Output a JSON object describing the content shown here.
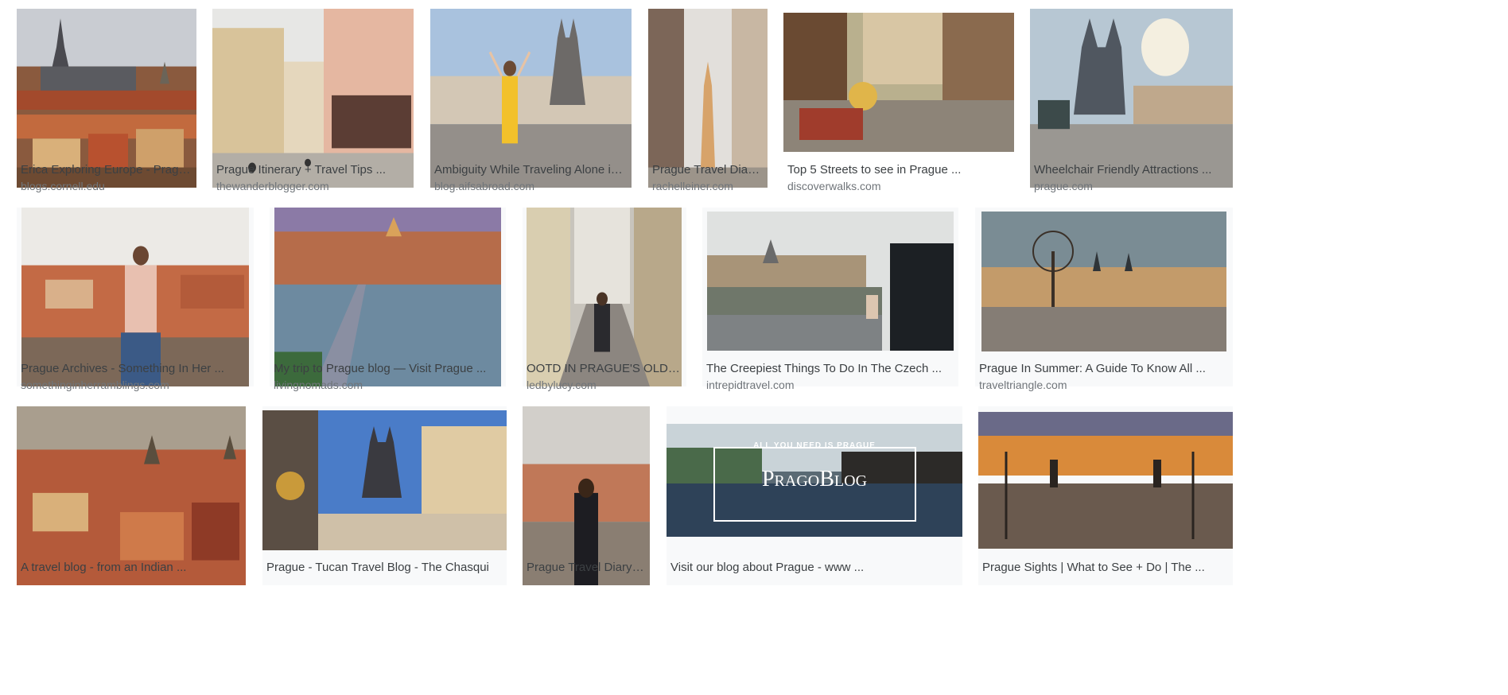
{
  "results": [
    [
      {
        "title": "Erica Exploring Europe - Prague Blog",
        "source": "blogs.cornell.edu",
        "thumb_icon": "prague-castle-panorama-image"
      },
      {
        "title": "Prague Itinerary + Travel Tips ...",
        "source": "thewanderblogger.com",
        "thumb_icon": "old-town-palace-street-image"
      },
      {
        "title": "Ambiguity While Traveling Alone in Prague",
        "source": "blog.aifsabroad.com",
        "thumb_icon": "woman-yellow-dress-square-image"
      },
      {
        "title": "Prague Travel Diary — ...",
        "source": "rachelleiner.com",
        "thumb_icon": "narrow-street-church-image"
      },
      {
        "title": "Top 5 Streets to see in Prague ...",
        "source": "discoverwalks.com",
        "thumb_icon": "cafe-street-image"
      },
      {
        "title": "Wheelchair Friendly Attractions ...",
        "source": "prague.com",
        "thumb_icon": "old-town-square-tyn-church-image"
      }
    ],
    [
      {
        "title": "Prague Archives - Something In Her ...",
        "source": "somethinginherramblings.com",
        "thumb_icon": "woman-sitting-rooftops-image"
      },
      {
        "title": "My trip to Prague blog — Visit Prague ...",
        "source": "livingnomads.com",
        "thumb_icon": "charles-bridge-aerial-image"
      },
      {
        "title": "OOTD IN PRAGUE'S OLD TOWN - ...",
        "source": "ledbylucy.com",
        "thumb_icon": "woman-cobblestone-alley-image"
      },
      {
        "title": "The Creepiest Things To Do In The Czech ...",
        "source": "intrepidtravel.com",
        "thumb_icon": "woman-photographing-bridge-image"
      },
      {
        "title": "Prague In Summer: A Guide To Know All ...",
        "source": "traveltriangle.com",
        "thumb_icon": "castle-square-tree-image"
      }
    ],
    [
      {
        "title": "A travel blog - from an Indian ...",
        "source": "",
        "thumb_icon": "red-roofs-cityscape-image"
      },
      {
        "title": "Prague - Tucan Travel Blog - The Chasqui",
        "source": "",
        "thumb_icon": "astronomical-clock-square-image"
      },
      {
        "title": "Prague Travel Diary — Ra...",
        "source": "",
        "thumb_icon": "woman-overlooking-city-image"
      },
      {
        "title": "Visit our blog about Prague - www ...",
        "source": "",
        "thumb_icon": "prago-blog-banner-image",
        "overlay": {
          "tagline": "ALL YOU NEED IS PRAGUE",
          "logo": "PragoBlog"
        }
      },
      {
        "title": "Prague Sights | What to See + Do | The ...",
        "source": "",
        "thumb_icon": "charles-bridge-sunset-image"
      }
    ]
  ]
}
